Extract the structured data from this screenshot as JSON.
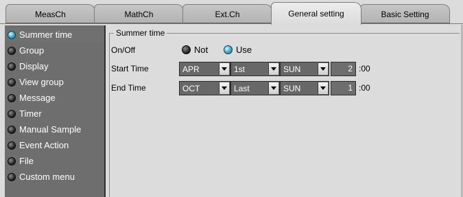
{
  "tabs": [
    {
      "label": "MeasCh",
      "active": false
    },
    {
      "label": "MathCh",
      "active": false
    },
    {
      "label": "Ext.Ch",
      "active": false
    },
    {
      "label": "General setting",
      "active": true
    },
    {
      "label": "Basic Setting",
      "active": false
    }
  ],
  "sidebar": {
    "items": [
      {
        "label": "Summer time",
        "active": true
      },
      {
        "label": "Group",
        "active": false
      },
      {
        "label": "Display",
        "active": false
      },
      {
        "label": "View group",
        "active": false
      },
      {
        "label": "Message",
        "active": false
      },
      {
        "label": "Timer",
        "active": false
      },
      {
        "label": "Manual Sample",
        "active": false
      },
      {
        "label": "Event Action",
        "active": false
      },
      {
        "label": "File",
        "active": false
      },
      {
        "label": "Custom menu",
        "active": false
      }
    ]
  },
  "panel": {
    "legend": "Summer time",
    "onoff": {
      "label": "On/Off",
      "options": [
        {
          "label": "Not",
          "selected": false
        },
        {
          "label": "Use",
          "selected": true
        }
      ]
    },
    "start": {
      "label": "Start Time",
      "month": "APR",
      "week": "1st",
      "day": "SUN",
      "hour": "2",
      "suffix": ":00"
    },
    "end": {
      "label": "End Time",
      "month": "OCT",
      "week": "Last",
      "day": "SUN",
      "hour": "1",
      "suffix": ":00"
    }
  },
  "colors": {
    "sidebar_bg": "#6e6e6e",
    "selected_radio": "#49b6d4",
    "field_bg": "#686868"
  }
}
